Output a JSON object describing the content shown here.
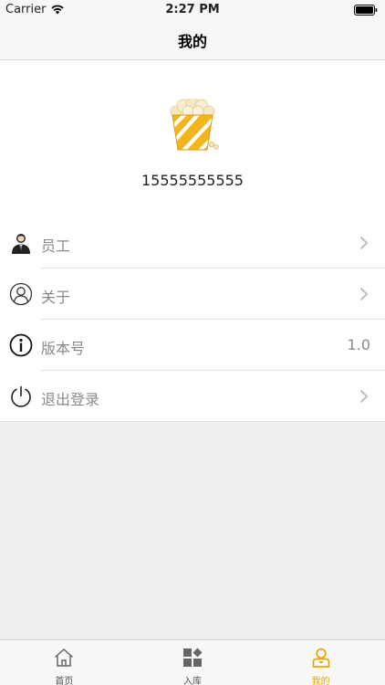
{
  "status_bar": {
    "carrier": "Carrier",
    "time": "2:27 PM"
  },
  "nav": {
    "title": "我的"
  },
  "profile": {
    "phone": "15555555555",
    "avatar_icon": "popcorn-icon"
  },
  "menu": {
    "items": [
      {
        "label": "员工",
        "icon": "employee-icon",
        "has_chevron": true
      },
      {
        "label": "关于",
        "icon": "about-icon",
        "has_chevron": true
      },
      {
        "label": "版本号",
        "icon": "info-icon",
        "value": "1.0"
      },
      {
        "label": "退出登录",
        "icon": "power-icon",
        "has_chevron": true
      }
    ]
  },
  "tabs": [
    {
      "label": "首页",
      "icon": "home-icon",
      "active": false
    },
    {
      "label": "入库",
      "icon": "inventory-icon",
      "active": false
    },
    {
      "label": "我的",
      "icon": "user-icon",
      "active": true
    }
  ],
  "colors": {
    "accent": "#e3a50a",
    "background": "#efefef",
    "secondary_text": "#8a8a8a"
  }
}
